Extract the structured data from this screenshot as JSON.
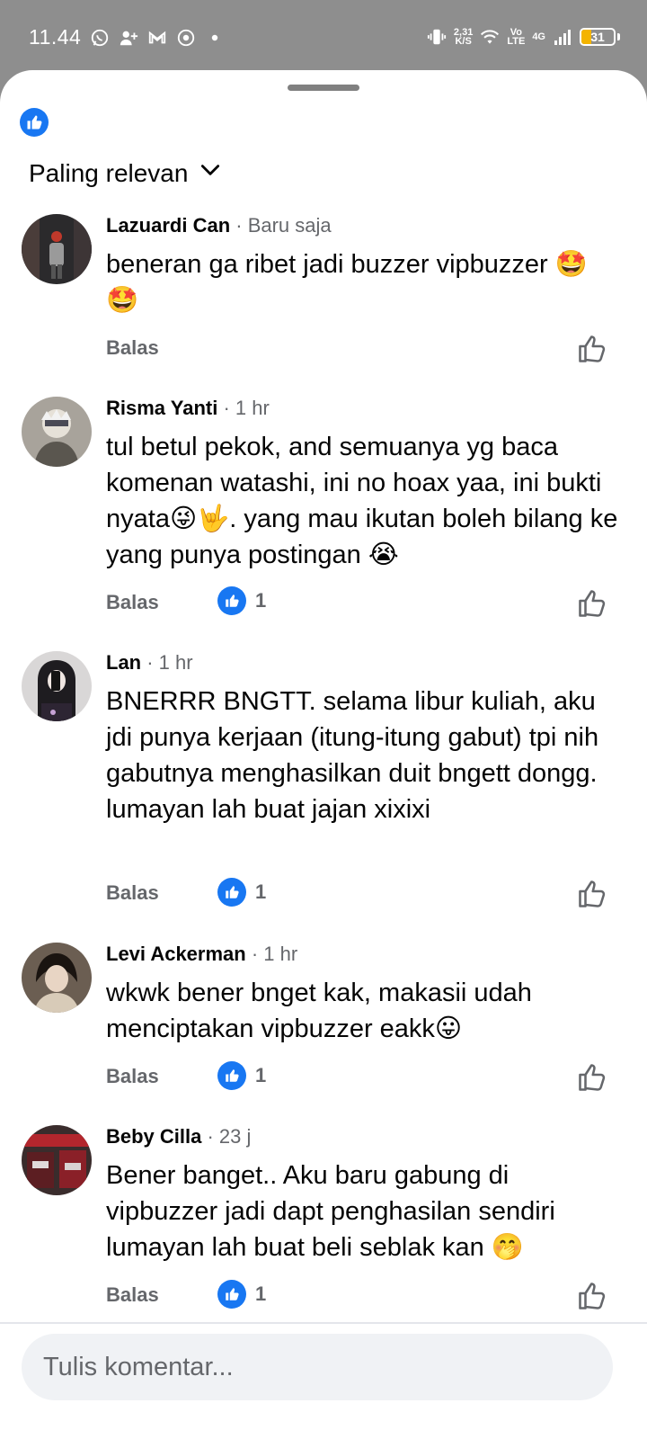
{
  "status_bar": {
    "time": "11.44",
    "speed_value": "2,31",
    "speed_unit": "K/S",
    "volte_top": "Vo",
    "volte_bottom": "LTE",
    "network": "4G",
    "battery": "31",
    "battery_level": 0.31,
    "notification_icons": [
      "whatsapp-icon",
      "person-add-icon",
      "gmail-icon",
      "chrome-icon",
      "dot-icon"
    ]
  },
  "sort": {
    "label": "Paling relevan"
  },
  "comments": [
    {
      "name": "Lazuardi Can",
      "time": " · Baru saja",
      "text": "beneran ga ribet jadi buzzer vipbuzzer 🤩🤩",
      "reply_label": "Balas",
      "reactions": null
    },
    {
      "name": "Risma Yanti",
      "time": " · 1 hr",
      "text": "tul betul pekok, and semuanya yg baca komenan watashi, ini no hoax yaa, ini bukti nyata😜🤟. yang mau ikutan boleh bilang ke yang punya postingan 😭",
      "reply_label": "Balas",
      "reactions": "1"
    },
    {
      "name": "Lan",
      "time": " · 1 hr",
      "text": "BNERRR BNGTT. selama libur kuliah, aku jdi punya kerjaan (itung-itung gabut) tpi nih gabutnya menghasilkan duit bngett dongg. lumayan lah buat jajan xixixi",
      "reply_label": "Balas",
      "reactions": "1"
    },
    {
      "name": "Levi Ackerman",
      "time": " · 1 hr",
      "text": "wkwk bener bnget kak, makasii udah menciptakan vipbuzzer eakk😛",
      "reply_label": "Balas",
      "reactions": "1"
    },
    {
      "name": "Beby Cilla",
      "time": " · 23 j",
      "text": "Bener banget.. Aku baru gabung di vipbuzzer jadi dapt penghasilan sendiri lumayan lah buat beli seblak kan 🤭",
      "reply_label": "Balas",
      "reactions": "1"
    }
  ],
  "composer": {
    "placeholder": "Tulis komentar..."
  },
  "colors": {
    "accent": "#1877f2",
    "secondary_text": "#65676b",
    "primary_text": "#050505"
  }
}
